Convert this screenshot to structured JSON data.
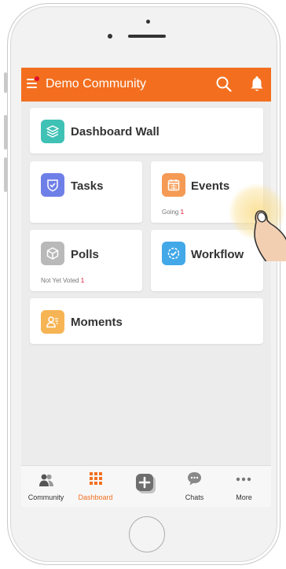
{
  "header": {
    "title": "Demo Community"
  },
  "cards": {
    "dashboard_wall": {
      "label": "Dashboard Wall"
    },
    "tasks": {
      "label": "Tasks"
    },
    "events": {
      "label": "Events",
      "sub_label": "Going",
      "sub_count": "1"
    },
    "polls": {
      "label": "Polls",
      "sub_label": "Not Yet Voted",
      "sub_count": "1"
    },
    "workflow": {
      "label": "Workflow"
    },
    "moments": {
      "label": "Moments"
    }
  },
  "bottom_nav": {
    "items": [
      {
        "label": "Community",
        "icon": "community-icon"
      },
      {
        "label": "Dashboard",
        "icon": "dashboard-grid-icon",
        "active": true
      },
      {
        "label": "",
        "icon": "add-icon"
      },
      {
        "label": "Chats",
        "icon": "chat-bubble-icon"
      },
      {
        "label": "More",
        "icon": "more-dots-icon"
      }
    ]
  },
  "colors": {
    "brand": "#f36f1f",
    "badge": "#e0102b",
    "dashboard_wall_icon": "#3fc1b5",
    "tasks_icon": "#6f7fe8",
    "events_icon": "#f59a55",
    "polls_icon": "#b9b9b9",
    "workflow_icon": "#42a8e8",
    "moments_icon": "#f7b454"
  }
}
